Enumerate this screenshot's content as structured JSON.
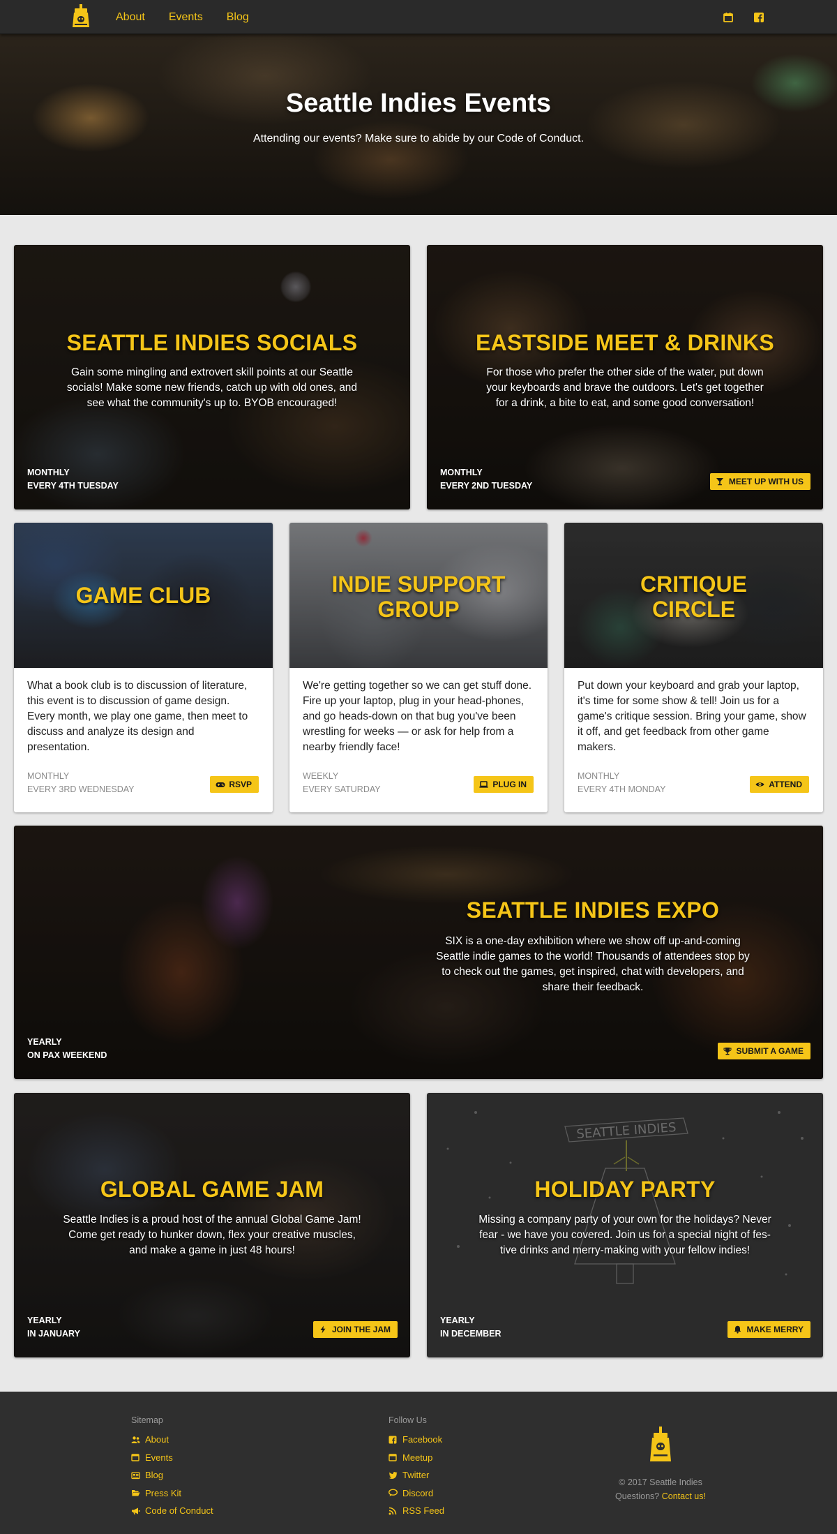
{
  "nav": {
    "links": [
      "About",
      "Events",
      "Blog"
    ],
    "icons": [
      "calendar-icon",
      "facebook-icon"
    ]
  },
  "hero": {
    "title": "Seattle Indies Events",
    "subtitle": "Attending our events? Make sure to abide by our Code of Conduct."
  },
  "events": {
    "socials": {
      "title": "SEATTLE INDIES SOCIALS",
      "desc": [
        "Gain some mingling and extrovert skill points at our Seattle",
        "socials! Make some new friends, catch up with old ones, and",
        "see what the community's up to. BYOB encouraged!"
      ],
      "freq": "MONTHLY",
      "when": "EVERY 4TH TUESDAY"
    },
    "eastside": {
      "title": "EASTSIDE MEET & DRINKS",
      "desc": [
        "For those who prefer the other side of the water, put down",
        "your keyboards and brave the outdoors. Let's get together",
        "for a drink, a bite to eat, and some good conversation!"
      ],
      "freq": "MONTHLY",
      "when": "EVERY 2ND TUESDAY",
      "button": "MEET UP WITH US",
      "button_icon": "cocktail-icon"
    },
    "gameclub": {
      "title": "GAME CLUB",
      "desc": "What a book club is to discussion of literature, this event is to discussion of game design. Every month, we play one game, then meet to discuss and analyze its design and presentation.",
      "freq": "MONTHLY",
      "when": "EVERY 3RD WEDNESDAY",
      "button": "RSVP",
      "button_icon": "gamepad-icon"
    },
    "support": {
      "title_lines": [
        "INDIE SUPPORT",
        "GROUP"
      ],
      "desc": "We're getting together so we can get stuff done. Fire up your laptop, plug in your head-phones, and go heads-down on that bug you've been wrestling for weeks — or ask for help from a nearby friendly face!",
      "freq": "WEEKLY",
      "when": "EVERY SATURDAY",
      "button": "PLUG IN",
      "button_icon": "laptop-icon"
    },
    "critique": {
      "title_lines": [
        "CRITIQUE",
        "CIRCLE"
      ],
      "desc": "Put down your keyboard and grab your laptop, it's time for some show & tell! Join us for a game's critique session. Bring your game, show it off, and get feedback from other game makers.",
      "freq": "MONTHLY",
      "when": "EVERY 4TH MONDAY",
      "button": "ATTEND",
      "button_icon": "eye-icon"
    },
    "expo": {
      "title": "SEATTLE INDIES EXPO",
      "desc": [
        "SIX is a one-day exhibition where we show off up-and-coming",
        "Seattle indie games to the world! Thousands of attendees stop by",
        "to check out the games, get inspired, chat with developers, and",
        "share their feedback."
      ],
      "freq": "YEARLY",
      "when": "ON PAX WEEKEND",
      "button": "SUBMIT A GAME",
      "button_icon": "trophy-icon"
    },
    "gamejam": {
      "title": "GLOBAL GAME JAM",
      "desc": [
        "Seattle Indies is a proud host of the annual Global Game Jam!",
        "Come get ready to hunker down, flex your creative muscles,",
        "and make a game in just 48 hours!"
      ],
      "freq": "YEARLY",
      "when": "IN JANUARY",
      "button": "JOIN THE JAM",
      "button_icon": "bolt-icon"
    },
    "holiday": {
      "title": "HOLIDAY PARTY",
      "sign": "SEATTLE INDIES",
      "desc": [
        "Missing a company party of your own for the holidays? Never",
        "fear - we have you covered. Join us for a special night of fes-",
        "tive drinks and merry-making with your fellow indies!"
      ],
      "freq": "YEARLY",
      "when": "IN DECEMBER",
      "button": "MAKE MERRY",
      "button_icon": "bell-icon"
    }
  },
  "footer": {
    "sitemap_title": "Sitemap",
    "sitemap": [
      {
        "label": "About",
        "icon": "users-icon"
      },
      {
        "label": "Events",
        "icon": "calendar-icon"
      },
      {
        "label": "Blog",
        "icon": "newspaper-icon"
      },
      {
        "label": "Press Kit",
        "icon": "folder-open-icon"
      },
      {
        "label": "Code of Conduct",
        "icon": "bullhorn-icon"
      }
    ],
    "follow_title": "Follow Us",
    "follow": [
      {
        "label": "Facebook",
        "icon": "facebook-icon"
      },
      {
        "label": "Meetup",
        "icon": "calendar-icon"
      },
      {
        "label": "Twitter",
        "icon": "twitter-icon"
      },
      {
        "label": "Discord",
        "icon": "chat-icon"
      },
      {
        "label": "RSS Feed",
        "icon": "rss-icon"
      }
    ],
    "copyright": "© 2017 Seattle Indies",
    "questions": "Questions?",
    "contact": "Contact us!"
  },
  "colors": {
    "accent": "#f5c518",
    "nav_bg": "#2a2a2a",
    "footer_bg": "#2f2f2f",
    "page_bg": "#e8e8e8"
  }
}
